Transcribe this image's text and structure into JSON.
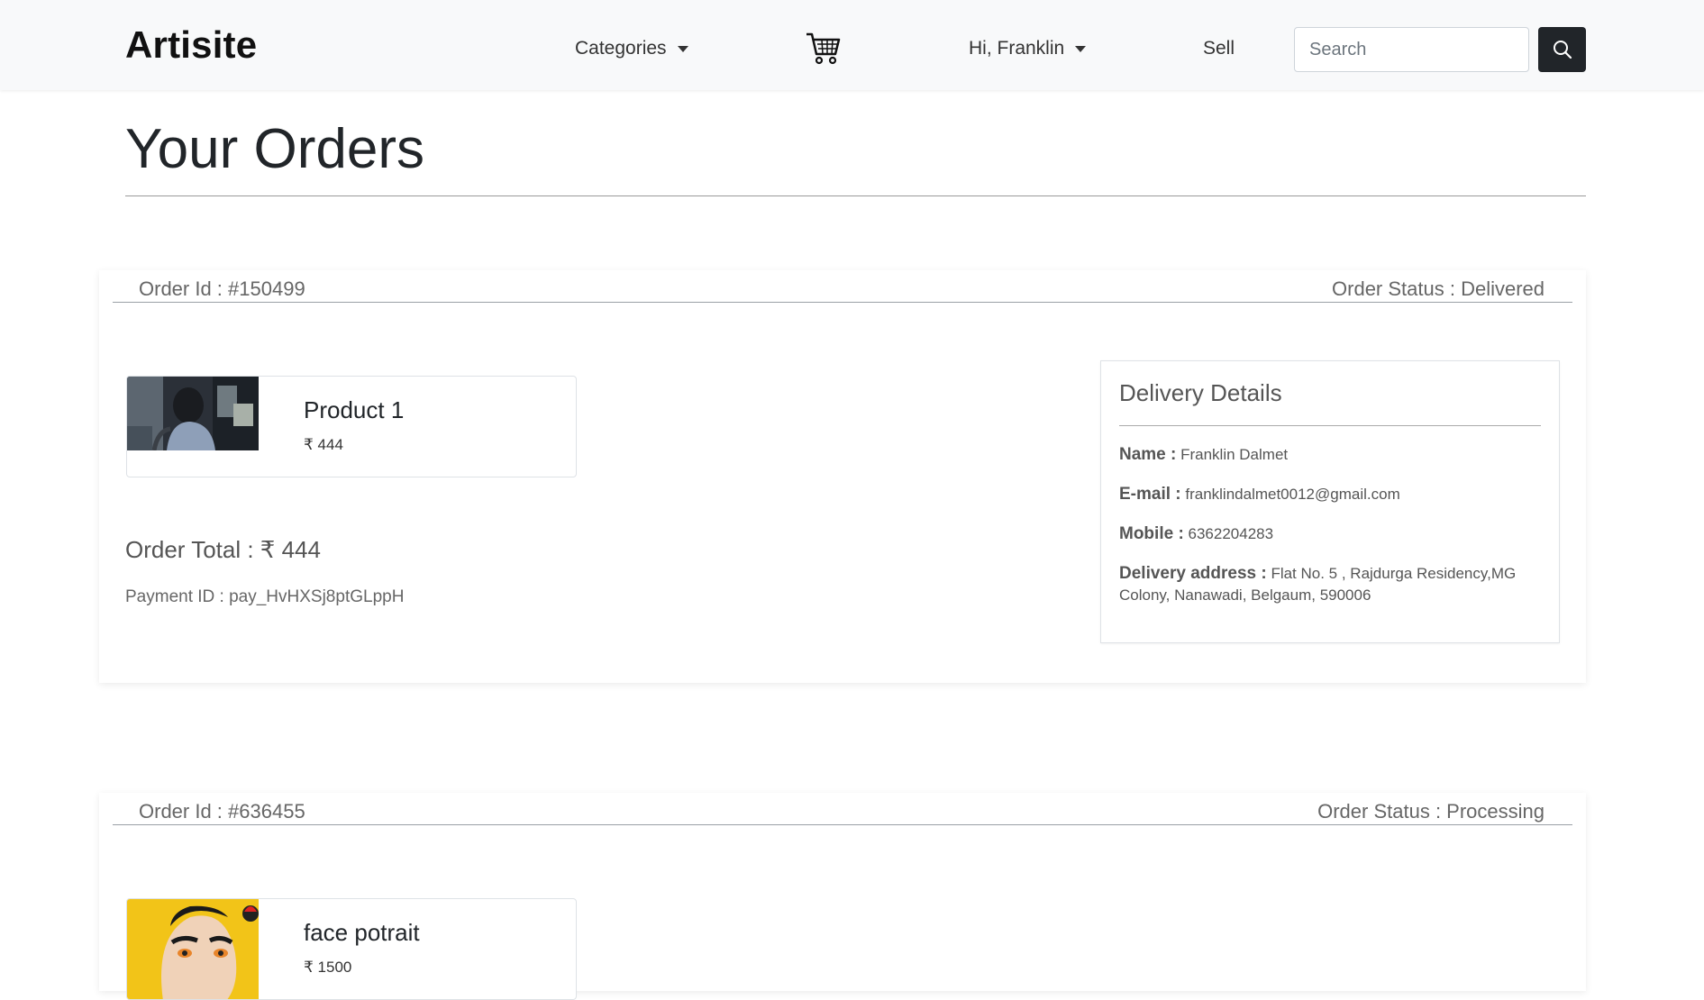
{
  "navbar": {
    "brand": "Artisite",
    "categories_label": "Categories",
    "user_label": "Hi, Franklin",
    "sell_label": "Sell",
    "search_placeholder": "Search"
  },
  "page": {
    "title": "Your Orders"
  },
  "orders": [
    {
      "order_id": "Order Id : #150499",
      "status": "Order Status : Delivered",
      "product": {
        "name": "Product 1",
        "price": "₹ 444"
      },
      "total": "Order Total : ₹ 444",
      "payment_id": "Payment ID : pay_HvHXSj8ptGLppH",
      "delivery": {
        "title": "Delivery Details",
        "name_key": "Name :",
        "name_val": "Franklin Dalmet",
        "email_key": "E-mail :",
        "email_val": "franklindalmet0012@gmail.com",
        "mobile_key": "Mobile :",
        "mobile_val": "6362204283",
        "address_key": "Delivery address :",
        "address_val": "Flat No. 5 , Rajdurga Residency,MG Colony, Nanawadi, Belgaum, 590006"
      }
    },
    {
      "order_id": "Order Id : #636455",
      "status": "Order Status : Processing",
      "product": {
        "name": "face potrait",
        "price": "₹ 1500"
      }
    }
  ],
  "colors": {
    "navbar_bg": "#f8f9fa",
    "search_button_bg": "#212529",
    "product2_img_bg": "#f2c418"
  },
  "icons": {
    "cart": "cart-icon",
    "search": "search-icon",
    "caret": "caret-down-icon"
  }
}
